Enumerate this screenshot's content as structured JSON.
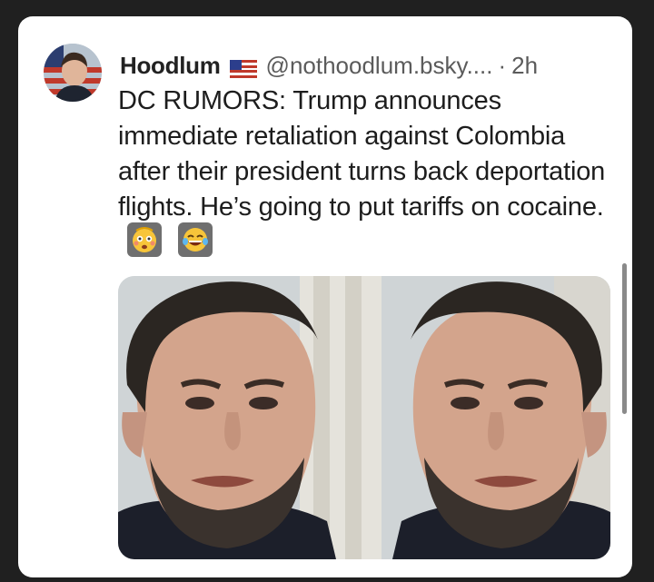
{
  "post": {
    "display_name": "Hoodlum",
    "handle": "@nothoodlum.bsky....",
    "separator": "·",
    "time": "2h",
    "text": "DC RUMORS: Trump announces immediate retaliation against Colombia after their president turns back deportation flights. He’s going to put tariffs on cocaine.",
    "emojis": [
      "flushed-face-emoji",
      "tears-of-joy-emoji"
    ]
  },
  "icons": {
    "flag": "us-flag-icon",
    "avatar": "avatar"
  },
  "colors": {
    "page_background": "#202020",
    "card_background": "#ffffff",
    "text": "#1d1d1d",
    "muted": "#5b5b5b"
  }
}
